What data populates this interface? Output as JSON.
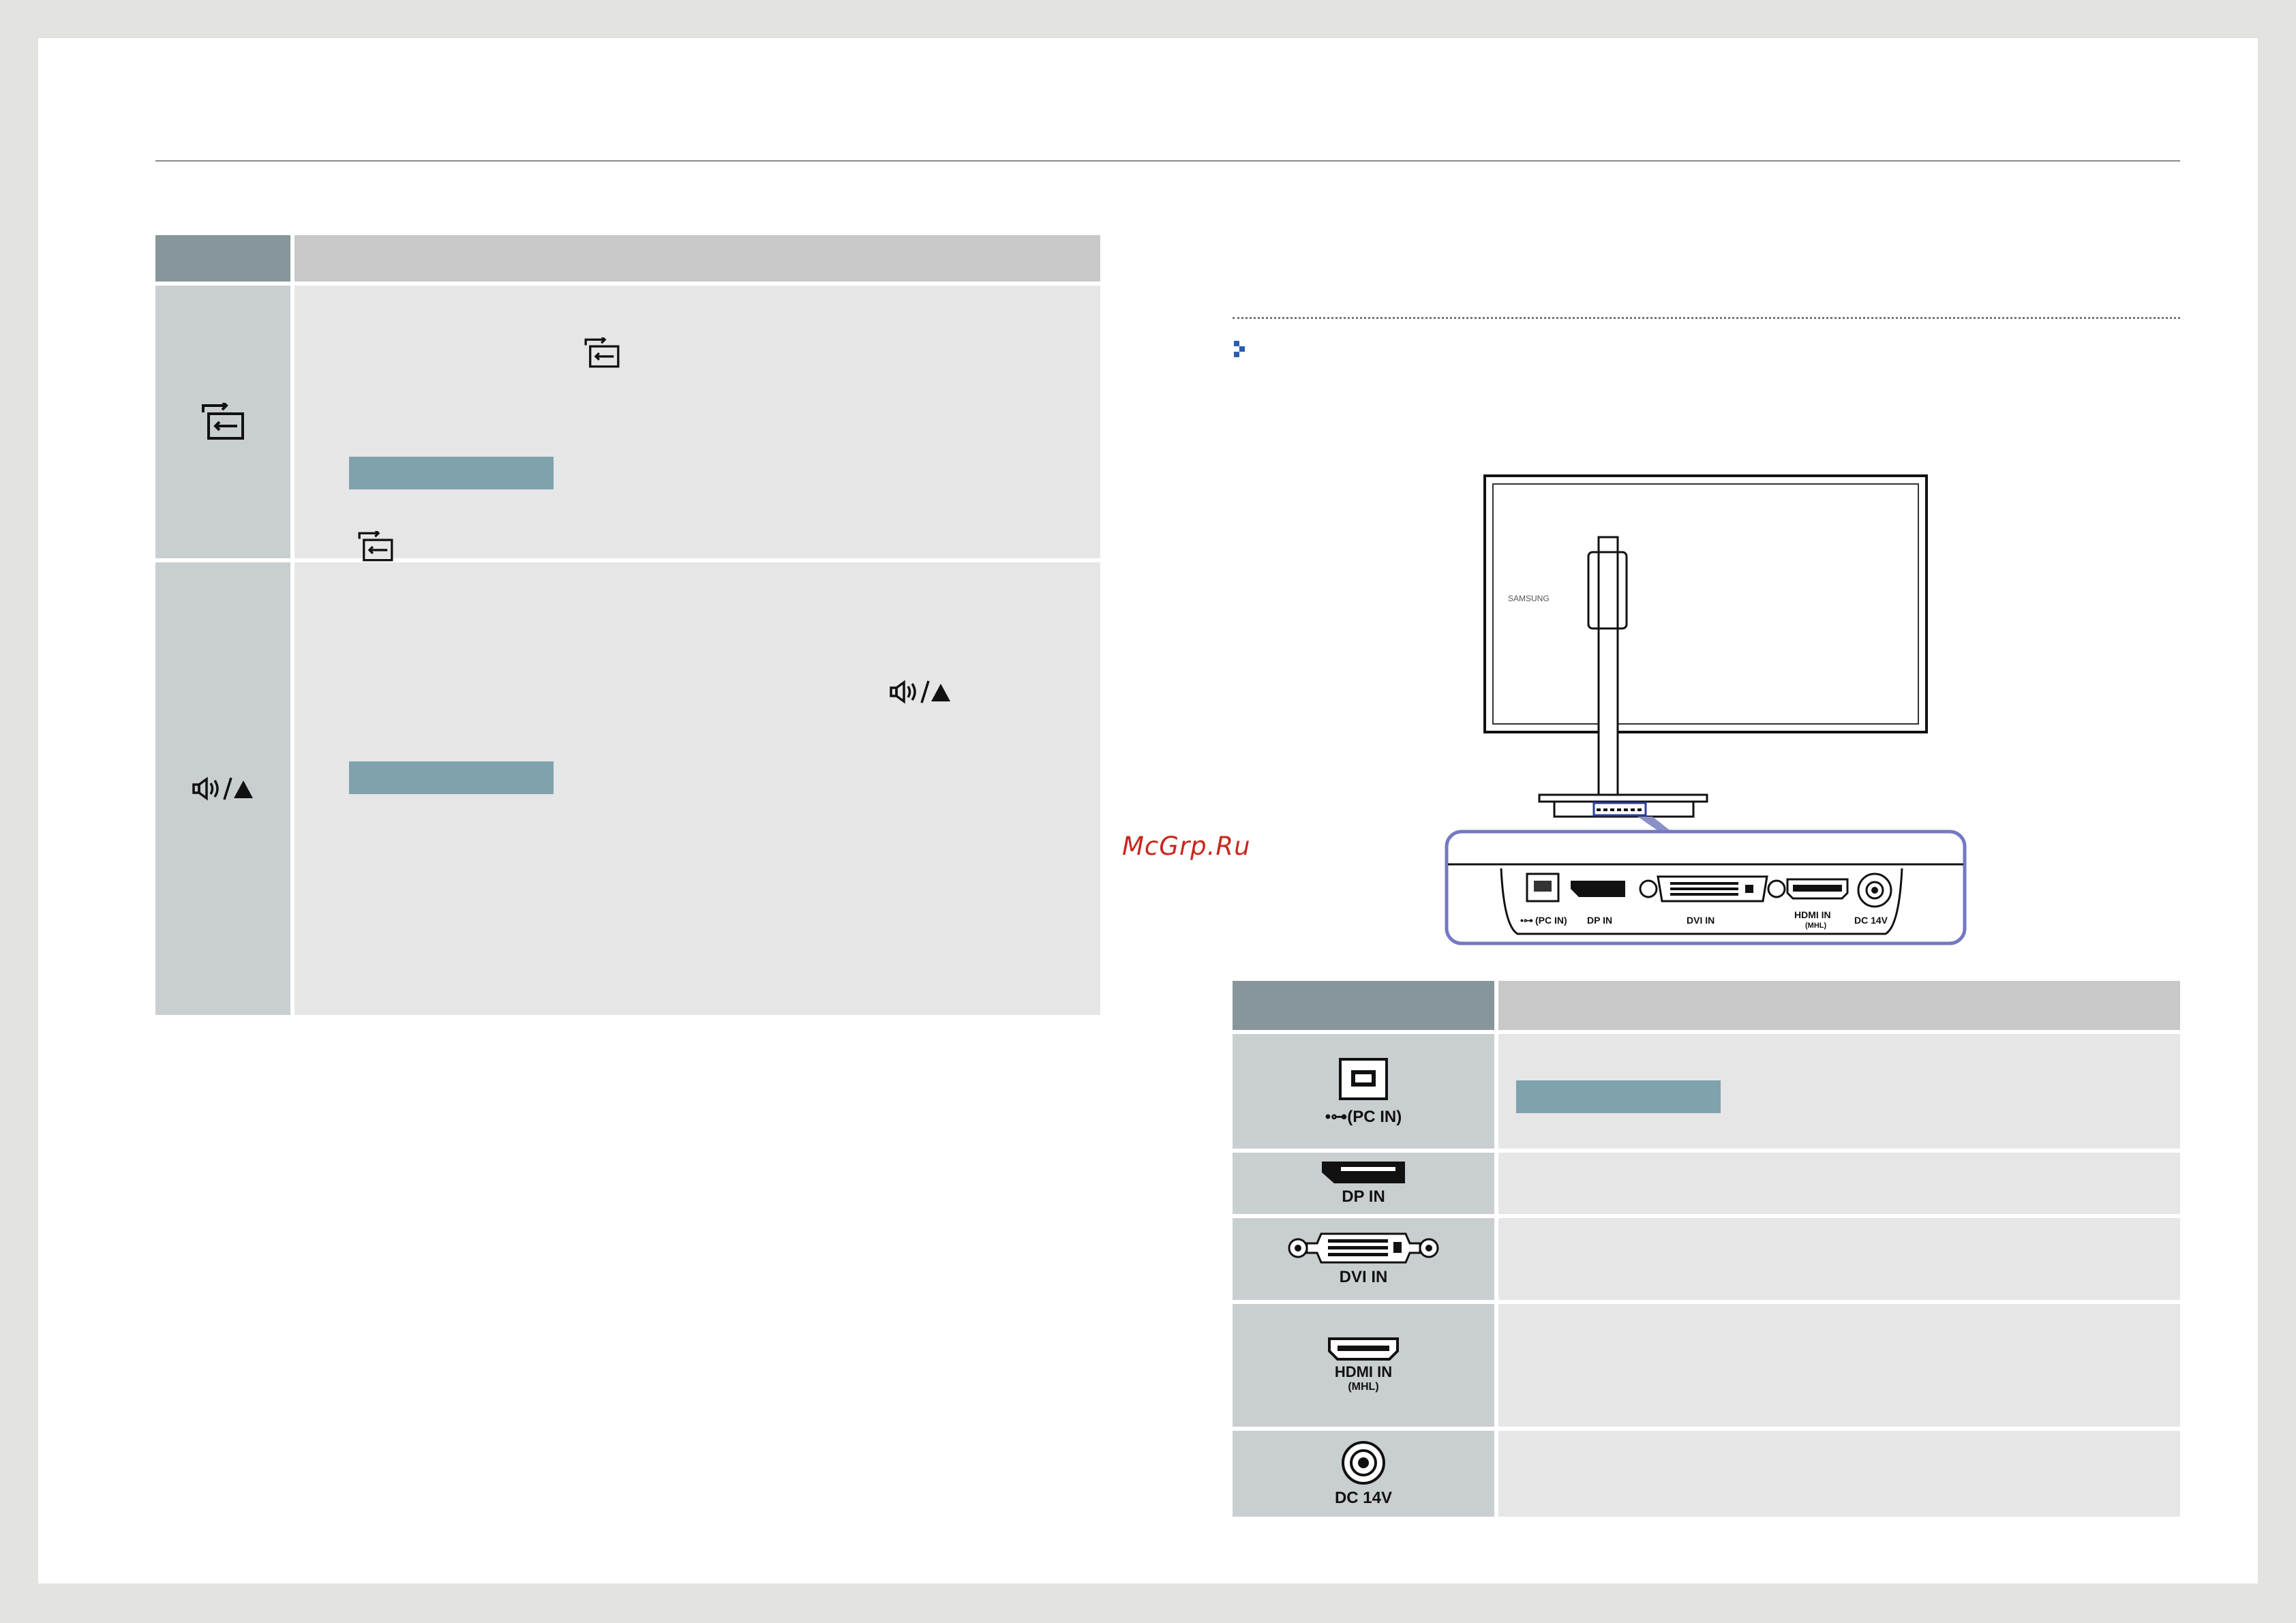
{
  "watermark": "McGrp.Ru",
  "left_table": {
    "row1": {
      "icon": "source-icon"
    },
    "row2": {
      "icon": "volume-eject-icon",
      "symbol": "◁))/▲"
    }
  },
  "diagram": {
    "brand": "SAMSUNG",
    "ports": {
      "usb": "(PC IN)",
      "dp": "DP IN",
      "dvi": "DVI IN",
      "hdmi": "HDMI IN",
      "hdmi_sub": "(MHL)",
      "dc": "DC 14V"
    }
  },
  "right_table": {
    "rows": [
      {
        "icon": "usb-b-port-icon",
        "label": "(PC IN)"
      },
      {
        "icon": "displayport-icon",
        "label": "DP IN"
      },
      {
        "icon": "dvi-port-icon",
        "label": "DVI IN"
      },
      {
        "icon": "hdmi-port-icon",
        "label": "HDMI IN",
        "sub": "(MHL)"
      },
      {
        "icon": "dc-jack-icon",
        "label": "DC 14V"
      }
    ]
  }
}
